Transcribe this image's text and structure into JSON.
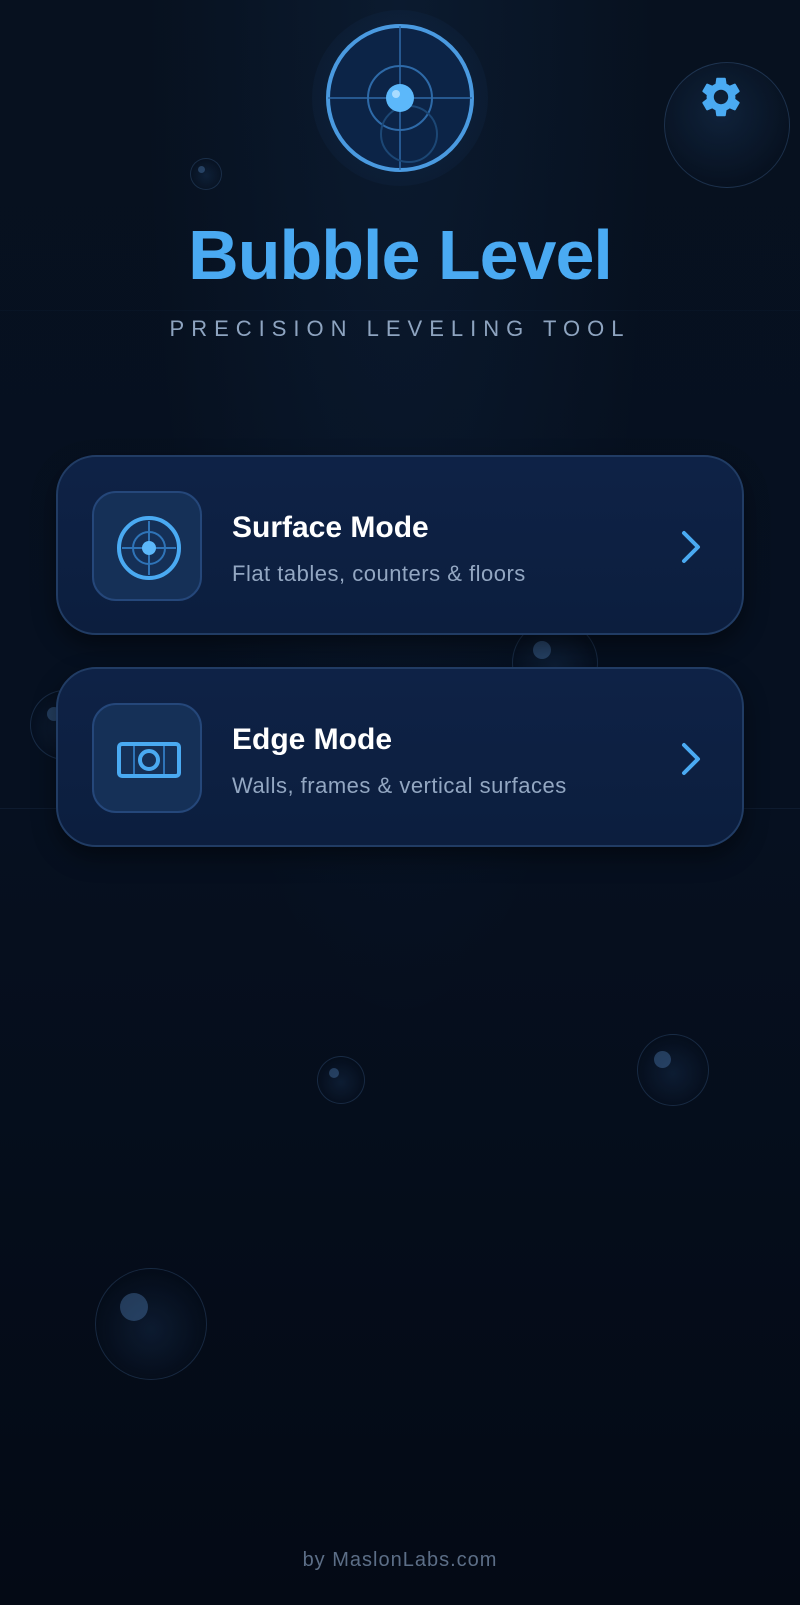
{
  "app": {
    "title": "Bubble Level",
    "subtitle": "PRECISION LEVELING TOOL"
  },
  "header": {
    "logo_icon": "bubble-level-logo-icon",
    "settings_icon": "gear-icon"
  },
  "modes": [
    {
      "title": "Surface Mode",
      "description": "Flat tables, counters & floors",
      "icon": "surface-target-icon"
    },
    {
      "title": "Edge Mode",
      "description": "Walls, frames & vertical surfaces",
      "icon": "edge-vial-icon"
    }
  ],
  "footer": {
    "text": "by MaslonLabs.com"
  },
  "colors": {
    "accent": "#4aaaf2",
    "background": "#050c18",
    "card": "#0e2246",
    "card_border": "#213c64",
    "subtitle": "#8ea4c0"
  }
}
